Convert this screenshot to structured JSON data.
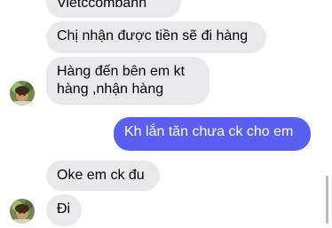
{
  "messages": [
    {
      "id": "msg-0",
      "direction": "incoming",
      "lines": [
        "Vietccombanh"
      ]
    },
    {
      "id": "msg-1",
      "direction": "incoming",
      "lines": [
        "Chị nhận được tiền sẽ đi hàng"
      ]
    },
    {
      "id": "msg-2",
      "direction": "incoming",
      "lines": [
        "Hàng đến bên em kt",
        "hàng ,nhận hàng"
      ]
    },
    {
      "id": "msg-3",
      "direction": "outgoing",
      "lines": [
        "Kh lắn tăn chưa ck cho em"
      ]
    },
    {
      "id": "msg-4",
      "direction": "incoming",
      "lines": [
        "Oke em ck đu"
      ]
    },
    {
      "id": "msg-5",
      "direction": "incoming",
      "lines": [
        "Đi"
      ]
    }
  ],
  "avatars": [
    {
      "icon": "contact-avatar"
    },
    {
      "icon": "contact-avatar"
    }
  ],
  "colors": {
    "incoming_bubble": "#e9e9eb",
    "outgoing_bubble": "#5b5ff1",
    "outgoing_text": "#ffffff",
    "background": "#ffffff"
  }
}
